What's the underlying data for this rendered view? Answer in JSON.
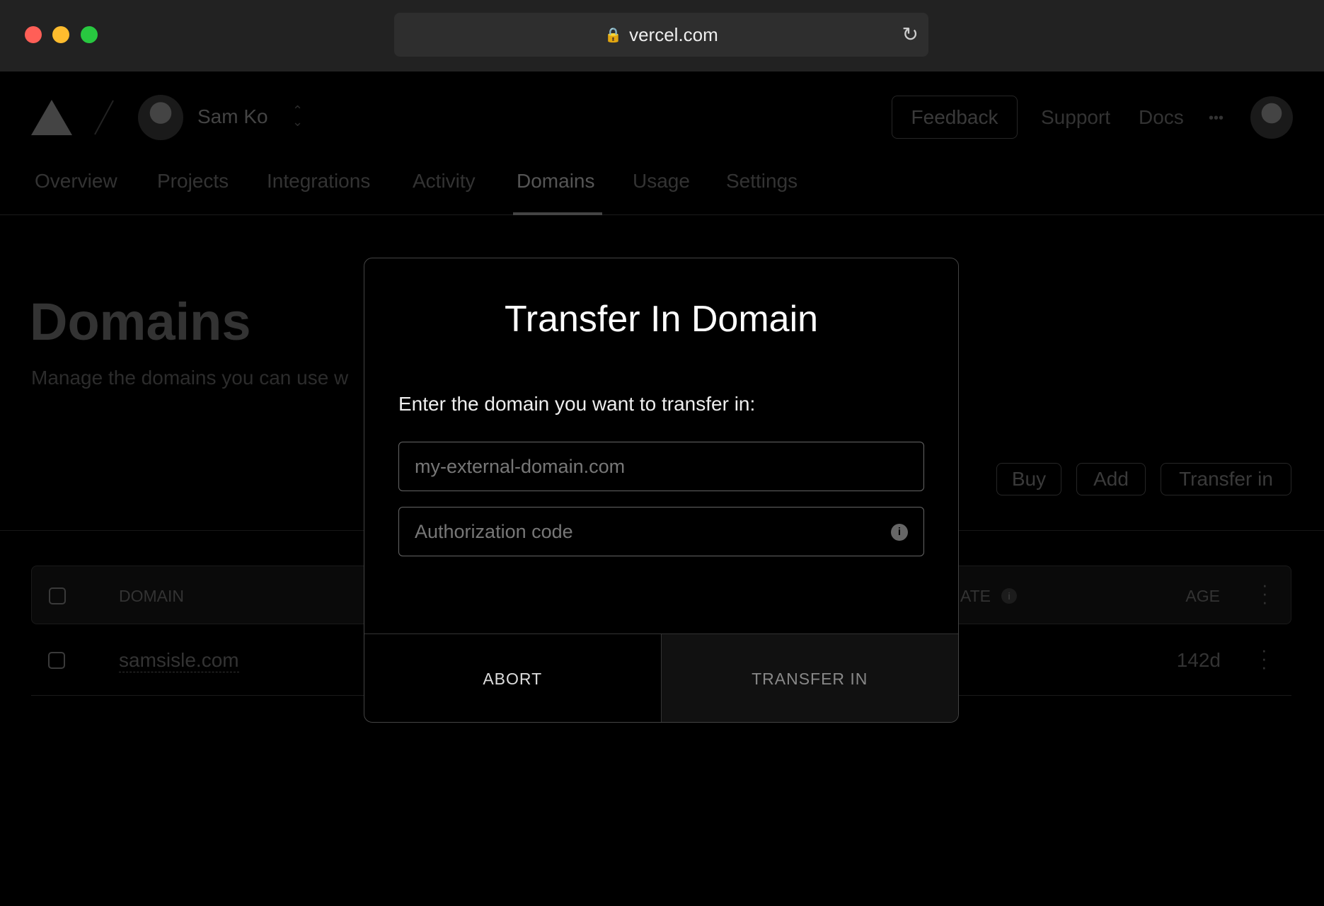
{
  "browser": {
    "url": "vercel.com",
    "lights": [
      "#ff5f57",
      "#febc2e",
      "#28c840"
    ]
  },
  "header": {
    "user": "Sam Ko",
    "feedback": "Feedback",
    "support": "Support",
    "docs": "Docs",
    "more": "•••"
  },
  "tabs": [
    {
      "label": "Overview"
    },
    {
      "label": "Projects"
    },
    {
      "label": "Integrations"
    },
    {
      "label": "Activity"
    },
    {
      "label": "Domains",
      "active": true
    },
    {
      "label": "Usage"
    },
    {
      "label": "Settings"
    }
  ],
  "page": {
    "title": "Domains",
    "subtitle": "Manage the domains you can use w",
    "buy": "Buy",
    "add": "Add",
    "transfer_in": "Transfer in"
  },
  "table": {
    "headers": {
      "domain": "DOMAIN",
      "date": "ATE",
      "age": "AGE"
    },
    "rows": [
      {
        "domain": "samsisle.com",
        "age": "142d"
      }
    ]
  },
  "modal": {
    "title": "Transfer In Domain",
    "label": "Enter the domain you want to transfer in:",
    "domain_placeholder": "my-external-domain.com",
    "auth_placeholder": "Authorization code",
    "abort": "ABORT",
    "submit": "TRANSFER IN"
  }
}
